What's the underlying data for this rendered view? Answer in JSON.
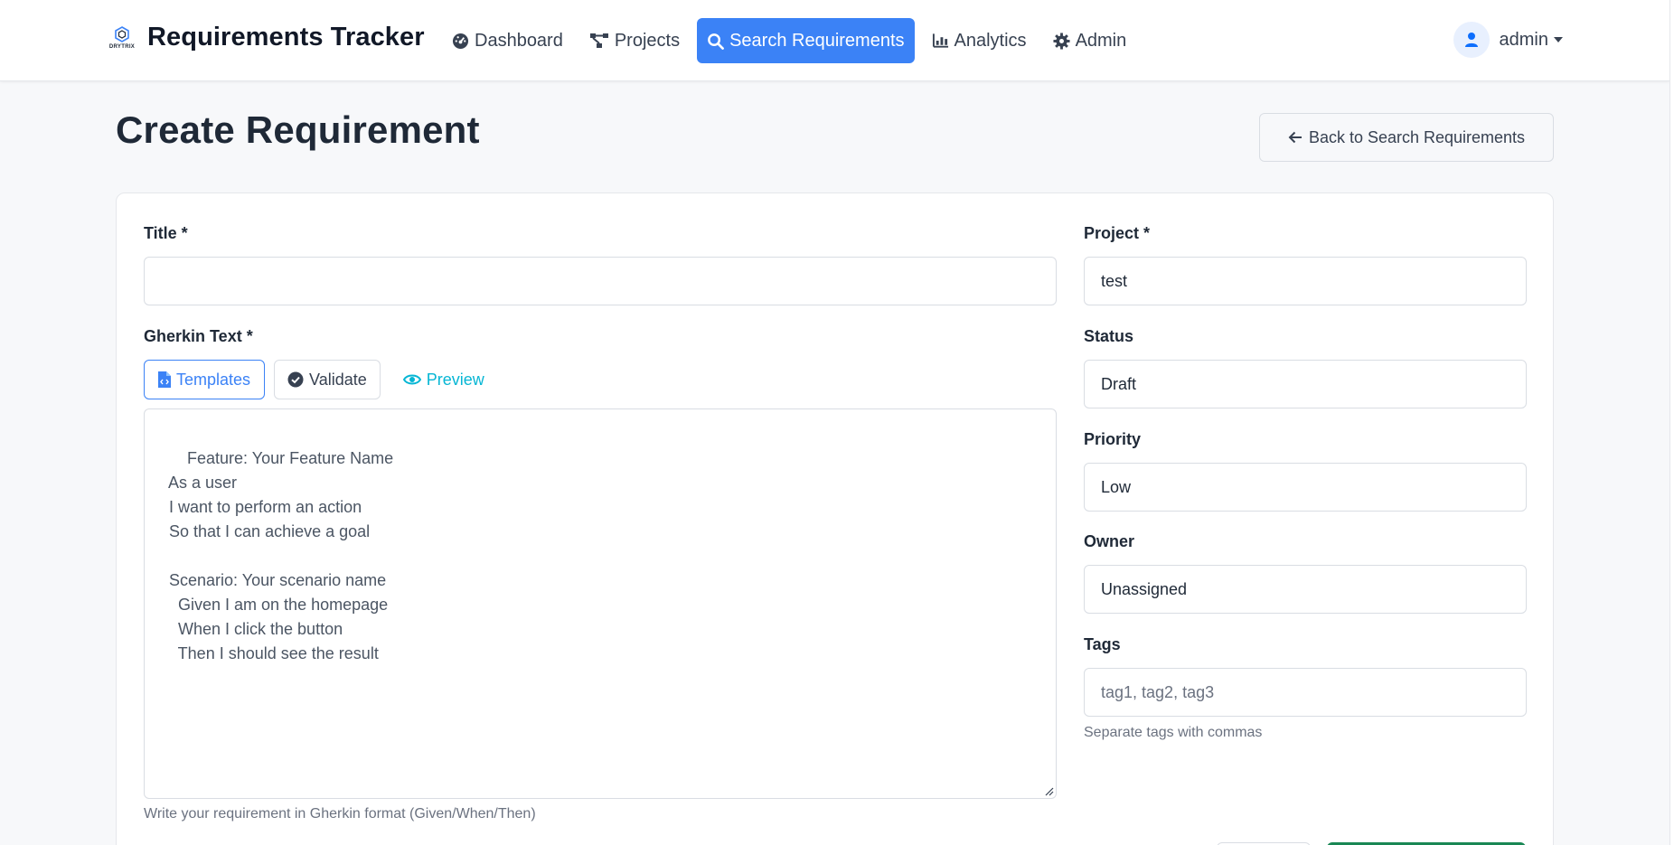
{
  "app": {
    "brand_name": "Requirements Tracker",
    "logo_text": "DRYTRIX"
  },
  "nav": {
    "items": [
      {
        "label": "Dashboard",
        "icon": "dashboard-icon"
      },
      {
        "label": "Projects",
        "icon": "projects-icon"
      },
      {
        "label": "Search Requirements",
        "icon": "search-icon",
        "active": true
      },
      {
        "label": "Analytics",
        "icon": "analytics-icon"
      },
      {
        "label": "Admin",
        "icon": "gear-icon"
      }
    ],
    "user": "admin"
  },
  "page": {
    "title": "Create Requirement",
    "back_label": "Back to Search Requirements"
  },
  "form": {
    "title_label": "Title *",
    "title_value": "",
    "gherkin_label": "Gherkin Text *",
    "toolbar": {
      "templates": "Templates",
      "validate": "Validate",
      "preview": "Preview"
    },
    "gherkin_text": "Feature: Your Feature Name\n  As a user\n  I want to perform an action\n  So that I can achieve a goal\n\n  Scenario: Your scenario name\n    Given I am on the homepage\n    When I click the button\n    Then I should see the result",
    "gherkin_help": "Write your requirement in Gherkin format (Given/When/Then)",
    "project_label": "Project *",
    "project_value": "test",
    "status_label": "Status",
    "status_value": "Draft",
    "priority_label": "Priority",
    "priority_value": "Low",
    "owner_label": "Owner",
    "owner_value": "Unassigned",
    "tags_label": "Tags",
    "tags_placeholder": "tag1, tag2, tag3",
    "tags_help": "Separate tags with commas"
  },
  "colors": {
    "primary": "#3b82f6",
    "info": "#06b6d4",
    "success": "#198754"
  }
}
